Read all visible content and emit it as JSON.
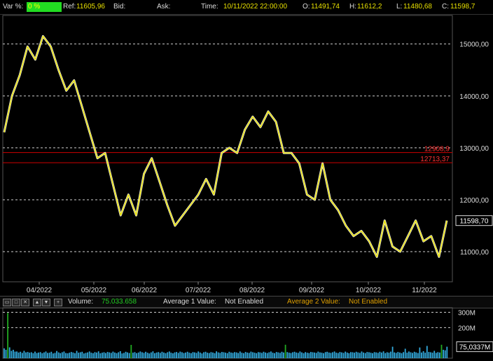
{
  "header": {
    "var_label": "Var %:",
    "var_value": "0 %",
    "ref_label": "Ref:",
    "ref_value": "11605,96",
    "bid_label": "Bid:",
    "ask_label": "Ask:",
    "time_label": "Time:",
    "time_value": "10/11/2022 22:00:00",
    "open_label": "O:",
    "open_value": "11491,74",
    "high_label": "H:",
    "high_value": "11612,2",
    "low_label": "L:",
    "low_value": "11480,68",
    "close_label": "C:",
    "close_value": "11598,7"
  },
  "colors": {
    "price_line": "#e8e000",
    "price_alt": "#ffffff",
    "hline": "#cc0000",
    "grid": "#cfcfcf",
    "volume": "#33aadd",
    "volume_high": "#22aa22",
    "var_box": "#22dd22"
  },
  "chart_data": [
    {
      "type": "line",
      "x_tick_labels": [
        "04/2022",
        "05/2022",
        "06/2022",
        "07/2022",
        "08/2022",
        "09/2022",
        "10/2022",
        "11/2022"
      ],
      "y_tick_labels": [
        "15000,00",
        "14000,00",
        "13000,00",
        "12000,00",
        "11000,00"
      ],
      "y_ticks": [
        15000,
        14000,
        13000,
        12000,
        11000
      ],
      "ylim": [
        10420,
        15550
      ],
      "grid": "horizontal dashed",
      "horizontal_lines": [
        {
          "value": 12908.9,
          "label": "12908,9"
        },
        {
          "value": 12713.37,
          "label": "12713,37"
        }
      ],
      "last_value_label": "11598,70",
      "last_value": 11598.7,
      "series": [
        {
          "values": [
            13300,
            14000,
            14400,
            14950,
            14700,
            15150,
            14950,
            14500,
            14100,
            14300,
            13800,
            13300,
            12800,
            12900,
            12300,
            11700,
            12100,
            11700,
            12500,
            12800,
            12350,
            11900,
            11500,
            11700,
            11900,
            12100,
            12400,
            12100,
            12900,
            13000,
            12900,
            13350,
            13600,
            13400,
            13700,
            13500,
            12900,
            12900,
            12700,
            12100,
            12000,
            12700,
            12000,
            11800,
            11500,
            11300,
            11400,
            11200,
            10900,
            11600,
            11100,
            11000,
            11300,
            11600,
            11200,
            11300,
            10900,
            11598.7
          ]
        }
      ]
    },
    {
      "type": "bar",
      "y_tick_labels": [
        "300M",
        "200M"
      ],
      "y_ticks": [
        300,
        200
      ],
      "ylim": [
        0,
        330
      ],
      "value_label": "75,0337M",
      "last_value": 75.0337,
      "values_M": [
        64,
        55,
        296,
        71,
        48,
        55,
        43,
        44,
        37,
        42,
        35,
        48,
        38,
        41,
        36,
        39,
        33,
        43,
        34,
        37,
        40,
        33,
        38,
        44,
        35,
        36,
        42,
        31,
        35,
        47,
        38,
        33,
        39,
        44,
        34,
        32,
        36,
        41,
        37,
        33,
        48,
        36,
        39,
        42,
        31,
        35,
        38,
        44,
        36,
        33,
        40,
        37,
        45,
        32,
        36,
        39,
        34,
        41,
        38,
        35,
        43,
        37,
        33,
        39,
        46,
        31,
        35,
        42,
        38,
        34,
        87,
        36,
        40,
        33,
        37,
        44,
        39,
        35,
        42,
        36,
        31,
        38,
        45,
        33,
        37,
        40,
        35,
        42,
        37,
        33,
        39,
        44,
        36,
        32,
        38,
        41,
        35,
        43,
        39,
        34,
        37,
        42,
        36,
        33,
        40,
        38,
        35,
        44,
        37,
        31,
        39,
        42,
        36,
        34,
        40,
        37,
        33,
        45,
        38,
        35,
        41,
        39,
        36,
        33,
        42,
        37,
        35,
        40,
        38,
        34,
        44,
        36,
        33,
        41,
        37,
        35,
        43,
        39,
        36,
        33,
        40,
        38,
        35,
        42,
        37,
        34,
        39,
        44,
        36,
        33,
        41,
        38,
        35,
        42,
        37,
        88,
        40,
        36,
        34,
        39,
        42,
        37,
        35,
        44,
        38,
        33,
        40,
        36,
        34,
        41,
        39,
        37,
        35,
        43,
        38,
        36,
        33,
        40,
        42,
        37,
        35,
        39,
        44,
        36,
        34,
        41,
        38,
        35,
        43,
        37,
        33,
        40,
        39,
        36,
        42,
        38,
        35,
        44,
        37,
        34,
        41,
        39,
        36,
        33,
        40,
        38,
        35,
        42,
        37,
        45,
        34,
        39,
        36,
        43,
        75,
        38,
        35,
        41,
        37,
        33,
        40,
        62,
        36,
        44,
        39,
        35,
        42,
        38,
        34,
        70,
        37,
        46,
        36,
        80,
        41,
        39,
        36,
        48,
        35,
        40,
        37,
        88,
        55,
        52,
        75
      ]
    }
  ],
  "volume_toolbar": {
    "buttons": [
      "▭",
      "□",
      "✕",
      "▲",
      "▼",
      "+"
    ],
    "volume_label": "Volume:",
    "volume_value": "75.033.658",
    "avg1_label": "Average 1 Value:",
    "avg1_value": "Not Enabled",
    "avg2_label": "Average 2 Value:",
    "avg2_value": "Not Enabled"
  }
}
